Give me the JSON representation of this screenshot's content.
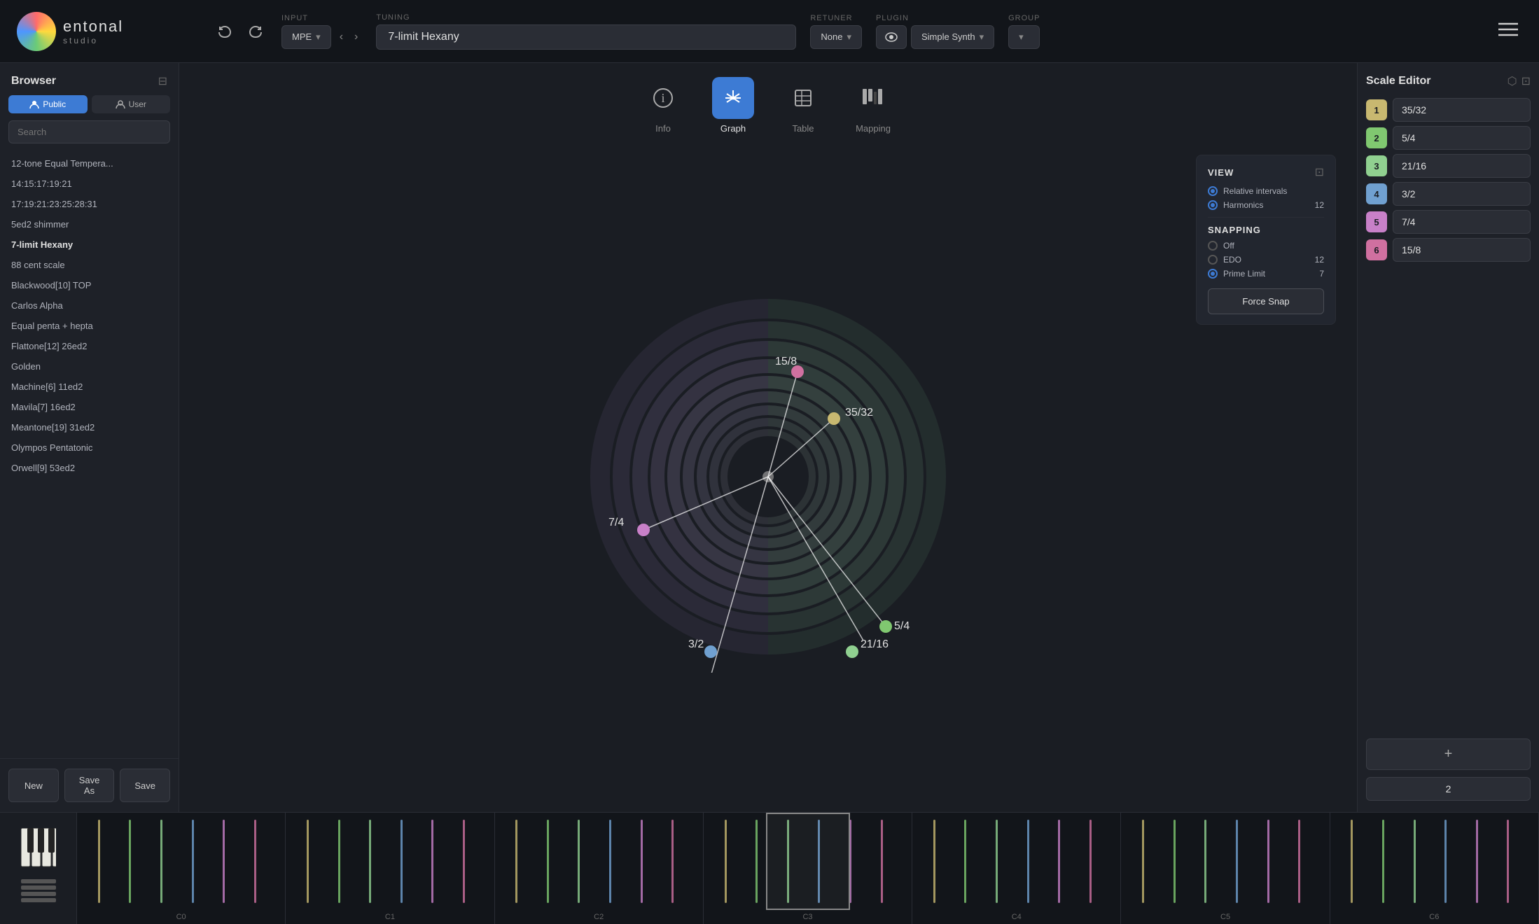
{
  "app": {
    "title": "entonal studio",
    "brand": "entonal",
    "sub": "studio"
  },
  "topbar": {
    "input_label": "INPUT",
    "tuning_label": "TUNING",
    "retuner_label": "RETUNER",
    "plugin_label": "PLUGIN",
    "group_label": "GROUP",
    "input_mode": "MPE",
    "tuning_name": "7-limit Hexany",
    "retuner": "None",
    "plugin": "Simple Synth",
    "undo_label": "↩",
    "redo_label": "↪"
  },
  "browser": {
    "title": "Browser",
    "public_label": "Public",
    "user_label": "User",
    "search_placeholder": "Search",
    "items": [
      {
        "label": "12-tone Equal Tempera...",
        "selected": false
      },
      {
        "label": "14:15:17:19:21",
        "selected": false
      },
      {
        "label": "17:19:21:23:25:28:31",
        "selected": false
      },
      {
        "label": "5ed2 shimmer",
        "selected": false
      },
      {
        "label": "7-limit Hexany",
        "selected": true
      },
      {
        "label": "88 cent scale",
        "selected": false
      },
      {
        "label": "Blackwood[10] TOP",
        "selected": false
      },
      {
        "label": "Carlos Alpha",
        "selected": false
      },
      {
        "label": "Equal penta + hepta",
        "selected": false
      },
      {
        "label": "Flattone[12] 26ed2",
        "selected": false
      },
      {
        "label": "Golden",
        "selected": false
      },
      {
        "label": "Machine[6] 11ed2",
        "selected": false
      },
      {
        "label": "Mavila[7] 16ed2",
        "selected": false
      },
      {
        "label": "Meantone[19] 31ed2",
        "selected": false
      },
      {
        "label": "Olympos Pentatonic",
        "selected": false
      },
      {
        "label": "Orwell[9] 53ed2",
        "selected": false
      }
    ],
    "new_label": "New",
    "save_as_label": "Save As",
    "save_label": "Save"
  },
  "view_tabs": [
    {
      "id": "info",
      "label": "Info",
      "icon": "ℹ",
      "active": false
    },
    {
      "id": "graph",
      "label": "Graph",
      "icon": "✳",
      "active": true
    },
    {
      "id": "table",
      "label": "Table",
      "icon": "⊞",
      "active": false
    },
    {
      "id": "mapping",
      "label": "Mapping",
      "icon": "🎹",
      "active": false
    }
  ],
  "graph": {
    "notes": [
      {
        "label": "35/32",
        "angle": 20,
        "radius": 0.72,
        "color": "#c8b870"
      },
      {
        "label": "7/4",
        "angle": 155,
        "radius": 0.72,
        "color": "#c880c8"
      },
      {
        "label": "15/8",
        "angle": 65,
        "radius": 0.88,
        "color": "#d070a0"
      },
      {
        "label": "3/2",
        "angle": 210,
        "radius": 0.6,
        "color": "#70a0d0"
      },
      {
        "label": "5/4",
        "angle": 335,
        "radius": 0.65,
        "color": "#80c870"
      },
      {
        "label": "21/16",
        "angle": 290,
        "radius": 0.55,
        "color": "#90d090"
      }
    ]
  },
  "view_panel": {
    "title": "VIEW",
    "collapse_icon": "⊡",
    "relative_intervals_label": "Relative intervals",
    "harmonics_label": "Harmonics",
    "harmonics_value": "12"
  },
  "snapping": {
    "title": "SNAPPING",
    "off_label": "Off",
    "edo_label": "EDO",
    "edo_value": "12",
    "prime_limit_label": "Prime Limit",
    "prime_limit_value": "7",
    "force_snap_label": "Force Snap"
  },
  "scale_editor": {
    "title": "Scale Editor",
    "notes": [
      {
        "num": "1",
        "value": "35/32",
        "color": "#c8b870"
      },
      {
        "num": "2",
        "value": "5/4",
        "color": "#80c870"
      },
      {
        "num": "3",
        "value": "21/16",
        "color": "#90d090"
      },
      {
        "num": "4",
        "value": "3/2",
        "color": "#70a0d0"
      },
      {
        "num": "5",
        "value": "7/4",
        "color": "#c880c8"
      },
      {
        "num": "6",
        "value": "15/8",
        "color": "#d070a0"
      }
    ],
    "add_label": "+",
    "octave_value": "2"
  },
  "piano_roll": {
    "octave_labels": [
      "C0",
      "C1",
      "C2",
      "C3",
      "C4",
      "C5",
      "C6"
    ]
  }
}
